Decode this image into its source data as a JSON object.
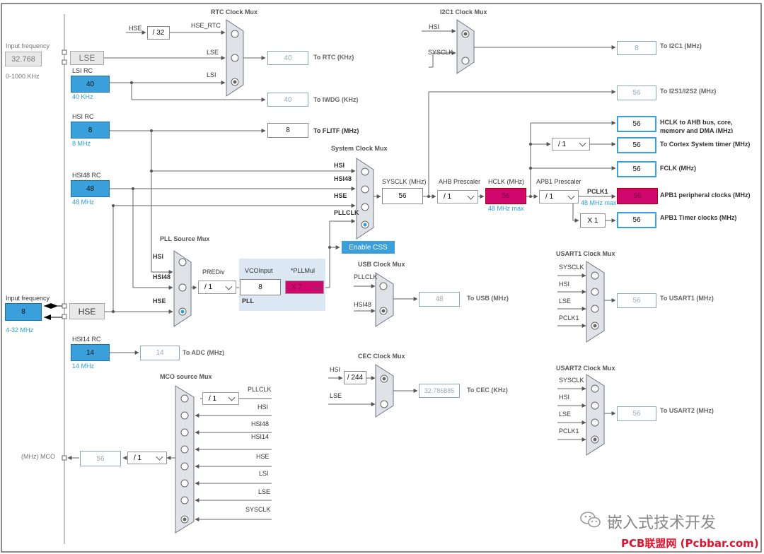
{
  "left_panel": {
    "input_freq_label_top": "Input frequency",
    "lse_input_value": "32.768",
    "lse_range": "0-1000 KHz",
    "lse_label": "LSE",
    "lsi_rc_label": "LSI RC",
    "lsi_value": "40",
    "lsi_unit": "40 KHz",
    "hsi_rc_label": "HSI RC",
    "hsi_value": "8",
    "hsi_unit": "8 MHz",
    "hsi48_rc_label": "HSI48 RC",
    "hsi48_value": "48",
    "hsi48_unit": "48 MHz",
    "input_freq_label_hse": "Input frequency",
    "hse_input_value": "8",
    "hse_range": "4-32 MHz",
    "hse_label": "HSE",
    "hsi14_rc_label": "HSI14 RC",
    "hsi14_value": "14",
    "hsi14_unit": "14 MHz",
    "mco_label": "(MHz) MCO"
  },
  "rtc": {
    "title": "RTC Clock Mux",
    "hse_in": "HSE",
    "div32": "/ 32",
    "hse_rtc": "HSE_RTC",
    "lse_in": "LSE",
    "lsi_in": "LSI",
    "rtc_value": "40",
    "rtc_label": "To RTC (KHz)",
    "iwdg_value": "40",
    "iwdg_label": "To IWDG (KHz)",
    "flitf_value": "8",
    "flitf_label": "To FLITF (MHz)"
  },
  "i2c1": {
    "title": "I2C1 Clock Mux",
    "hsi_in": "HSI",
    "sysclk_in": "SYSCLK",
    "i2c1_value": "8",
    "i2c1_label": "To I2C1 (MHz)",
    "i2s_value": "56",
    "i2s_label": "To I2S1/I2S2 (MHz)"
  },
  "sysmux": {
    "title": "System Clock Mux",
    "hsi": "HSI",
    "hsi48": "HSI48",
    "hse": "HSE",
    "pllclk": "PLLCLK",
    "enable_css": "Enable CSS"
  },
  "bus": {
    "sysclk_label": "SYSCLK (MHz)",
    "sysclk_value": "56",
    "ahb_label": "AHB Prescaler",
    "ahb_value": "/ 1",
    "hclk_label": "HCLK (MHz)",
    "hclk_value": "56",
    "hclk_max": "48 MHz max",
    "apb1_label": "APB1 Prescaler",
    "apb1_value": "/ 1",
    "pclk1_label": "PCLK1",
    "pclk1_max": "48 MHz max",
    "cortex_div": "/ 1",
    "x1": "X 1"
  },
  "outputs": {
    "hclk_ahb_value": "56",
    "hclk_ahb_label1": "HCLK to AHB bus, core,",
    "hclk_ahb_label2": "memory and DMA (MHz)",
    "cortex_value": "56",
    "cortex_label": "To Cortex System timer (MHz)",
    "fclk_value": "56",
    "fclk_label": "FCLK (MHz)",
    "apb1_periph_value": "56",
    "apb1_periph_label": "APB1 peripheral clocks (MHz)",
    "apb1_timer_value": "56",
    "apb1_timer_label": "APB1 Timer clocks (MHz)"
  },
  "pll": {
    "title": "PLL Source Mux",
    "hsi": "HSI",
    "hsi48": "HSI48",
    "hse": "HSE",
    "prediv_label": "PREDiv",
    "prediv_value": "/ 1",
    "vco_label": "VCOInput",
    "vco_value": "8",
    "pllmul_label": "*PLLMul",
    "pllmul_value": "X 7",
    "pll_label": "PLL"
  },
  "usb": {
    "title": "USB Clock Mux",
    "pllclk": "PLLCLK",
    "hsi48": "HSI48",
    "value": "48",
    "label": "To USB (MHz)"
  },
  "adc": {
    "value": "14",
    "label": "To ADC (MHz)"
  },
  "cec": {
    "title": "CEC Clock Mux",
    "hsi": "HSI",
    "div": "/ 244",
    "lse": "LSE",
    "value": "32.786885",
    "label": "To CEC (KHz)"
  },
  "usart1": {
    "title": "USART1 Clock Mux",
    "in1": "SYSCLK",
    "in2": "HSI",
    "in3": "LSE",
    "in4": "PCLK1",
    "value": "56",
    "label": "To USART1 (MHz)"
  },
  "usart2": {
    "title": "USART2 Clock Mux",
    "in1": "SYSCLK",
    "in2": "HSI",
    "in3": "LSE",
    "in4": "PCLK1",
    "value": "56",
    "label": "To USART2 (MHz)"
  },
  "mco": {
    "title": "MCO source Mux",
    "pll_div": "/ 1",
    "in_pllclk": "PLLCLK",
    "in_hsi": "HSI",
    "in_hsi48": "HSI48",
    "in_hsi14": "HSI14",
    "in_hse": "HSE",
    "in_lsi": "LSI",
    "in_lse": "LSE",
    "in_sysclk": "SYSCLK",
    "out_div": "/ 1",
    "out_value": "56"
  },
  "watermark": {
    "wechat_text": "嵌入式技术开发",
    "site_text": "PCB联盟网 (Pcbbar.com)"
  }
}
